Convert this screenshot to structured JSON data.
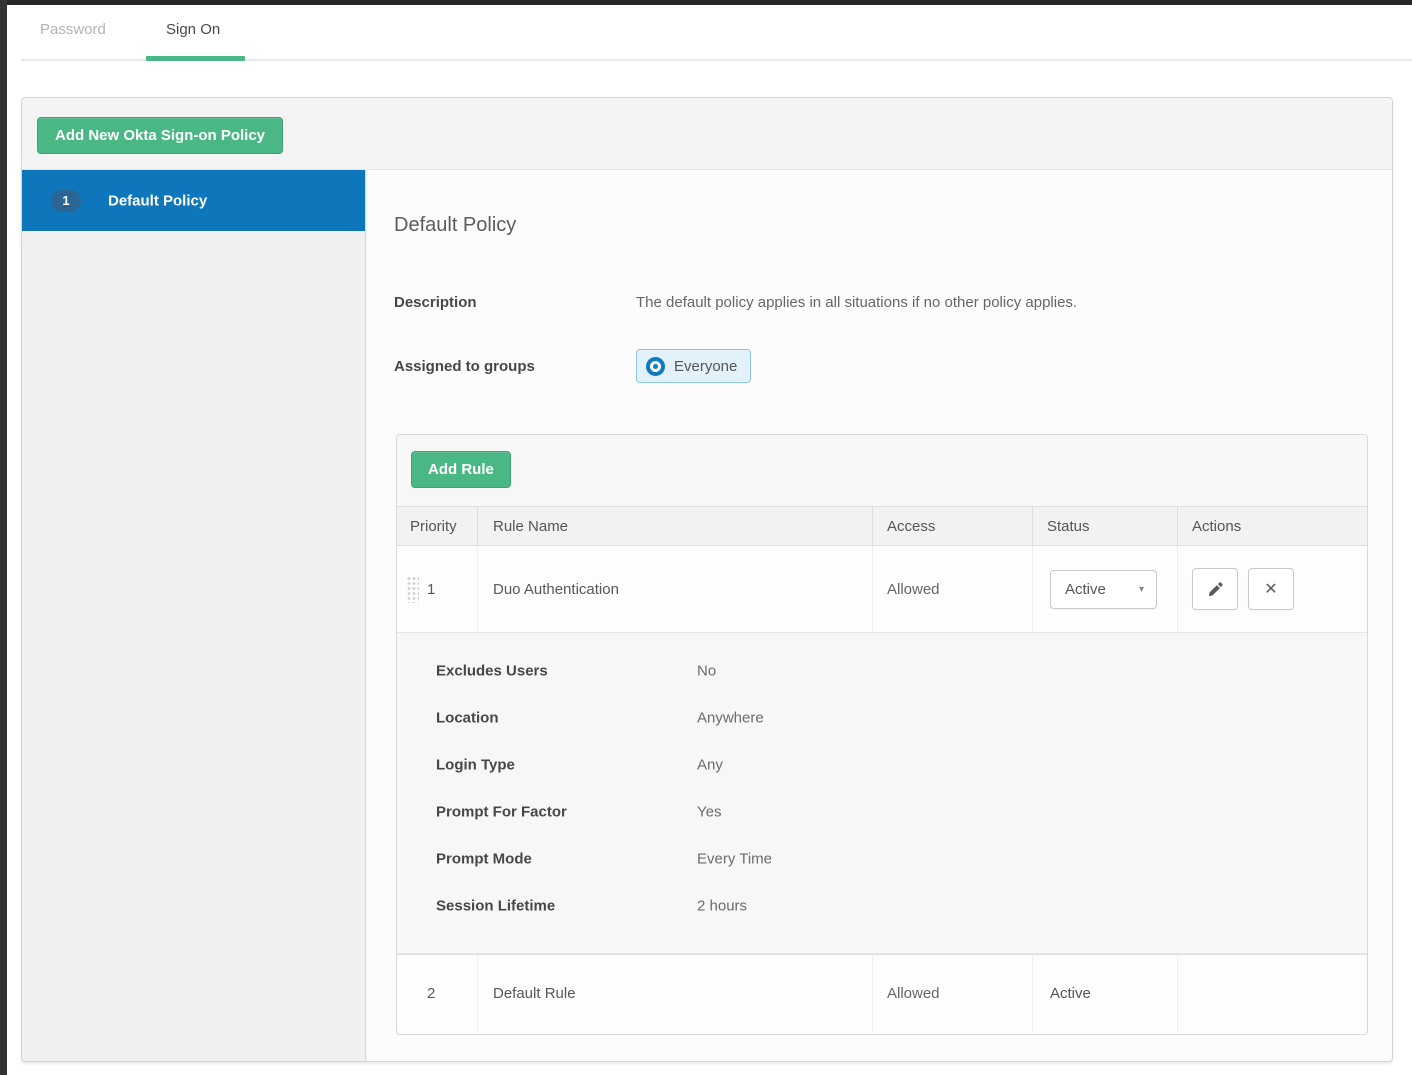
{
  "tabs": [
    {
      "label": "Password",
      "active": false
    },
    {
      "label": "Sign On",
      "active": true
    }
  ],
  "toolbar": {
    "add_policy_label": "Add New Okta Sign-on Policy"
  },
  "policies": [
    {
      "number": "1",
      "name": "Default Policy",
      "selected": true
    }
  ],
  "detail": {
    "title": "Default Policy",
    "description_label": "Description",
    "description_value": "The default policy applies in all situations if no other policy applies.",
    "assigned_label": "Assigned to groups",
    "assigned_group": "Everyone"
  },
  "rules": {
    "add_rule_label": "Add Rule",
    "columns": [
      "Priority",
      "Rule Name",
      "Access",
      "Status",
      "Actions"
    ],
    "rows": [
      {
        "priority": "1",
        "name": "Duo Authentication",
        "access": "Allowed",
        "status": "Active",
        "details": [
          {
            "label": "Excludes Users",
            "value": "No"
          },
          {
            "label": "Location",
            "value": "Anywhere"
          },
          {
            "label": "Login Type",
            "value": "Any"
          },
          {
            "label": "Prompt For Factor",
            "value": "Yes"
          },
          {
            "label": "Prompt Mode",
            "value": "Every Time"
          },
          {
            "label": "Session Lifetime",
            "value": "2 hours"
          }
        ]
      },
      {
        "priority": "2",
        "name": "Default Rule",
        "access": "Allowed",
        "status": "Active"
      }
    ]
  },
  "icons": {
    "drag_handle": "drag-handle-dots",
    "group_icon": "okta-o-circle",
    "edit": "pencil-icon",
    "delete": "x-icon",
    "dropdown_caret": "chevron-down"
  },
  "colors": {
    "accent_green": "#4ab884",
    "selected_blue": "#0e76bb",
    "badge_blue": "#2b6592",
    "chip_background": "#e3f1fb",
    "chip_border": "#8cc6ea",
    "chip_icon_blue": "#0d7ac2"
  }
}
